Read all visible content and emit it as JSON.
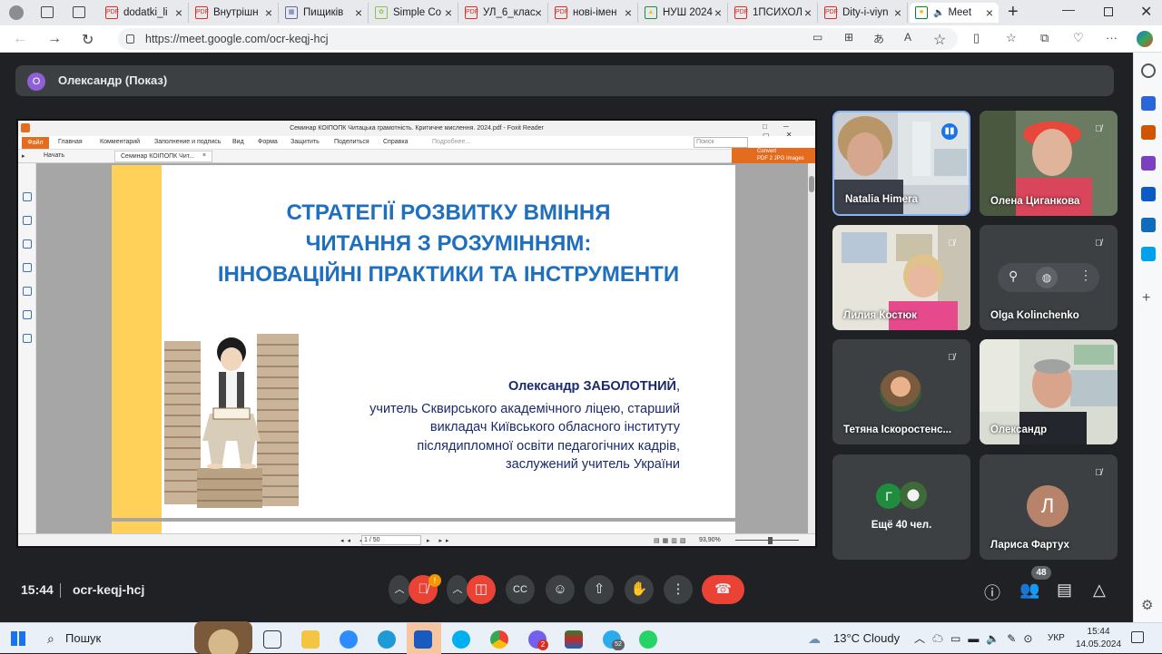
{
  "browser": {
    "tabs": [
      {
        "label": "dodatki_li"
      },
      {
        "label": "Внутрішн"
      },
      {
        "label": "Пищиків"
      },
      {
        "label": "Simple Co"
      },
      {
        "label": "УЛ_6_клас"
      },
      {
        "label": "нові-імен"
      },
      {
        "label": "НУШ 2024"
      },
      {
        "label": "1ПСИХОЛ"
      },
      {
        "label": "Dity-i-viyn"
      },
      {
        "label": "Meet"
      }
    ],
    "url": "https://meet.google.com/ocr-keqj-hcj"
  },
  "meet": {
    "presenter_initial": "О",
    "presenter_label": "Олександр (Показ)",
    "time": "15:44",
    "meeting_code": "ocr-keqj-hcj",
    "people_count": "48",
    "mic_badge": "!",
    "more_people_initial": "Г",
    "more_people_label": "Ещё 40 чел."
  },
  "foxit": {
    "title": "Семинар КОІПОПК Читацька грамотність. Критичне мислення. 2024.pdf - Foxit Reader",
    "menu": [
      "Файл",
      "Главная",
      "Комментарий",
      "Заполнение и подпись",
      "Вид",
      "Форма",
      "Защитить",
      "Поделиться",
      "Справка",
      "Подробнее..."
    ],
    "search_placeholder": "Поиск",
    "tabs": [
      "Начать",
      "Семинар КОІПОПК Чит..."
    ],
    "convert_line1": "Convert",
    "convert_line2": "PDF 2 JPG Images",
    "page_indicator": "1 / 50",
    "zoom": "93,90%"
  },
  "slide": {
    "title_lines": [
      "СТРАТЕГІЇ РОЗВИТКУ ВМІННЯ",
      "ЧИТАННЯ З РОЗУМІННЯМ:",
      "ІННОВАЦІЙНІ ПРАКТИКИ ТА ІНСТРУМЕНТИ"
    ],
    "author_name": "Олександр ЗАБОЛОТНИЙ",
    "author_comma": ",",
    "author_lines": [
      "учитель Сквирського академічного ліцею, старший",
      "викладач Київського обласного інституту",
      "післядипломної освіти педагогічних кадрів,",
      "заслужений учитель України"
    ]
  },
  "participants": [
    {
      "name": "Natalia Himera"
    },
    {
      "name": "Олена Циганкова"
    },
    {
      "name": "Лилия Костюк"
    },
    {
      "name": "Olga Kolinchenko"
    },
    {
      "name": "Тетяна Іскоростенс..."
    },
    {
      "name": "Олександр"
    },
    {
      "name": "Лариса Фартух",
      "initial": "Л"
    }
  ],
  "taskbar": {
    "search": "Пошук",
    "weather": "13°C  Cloudy",
    "lang": "УКР",
    "time": "15:44",
    "date": "14.05.2024",
    "badge_viber": "2",
    "badge_telegram": "52"
  },
  "colors": {
    "accent_orange": "#e46c1f",
    "meet_red": "#ea4335",
    "slide_blue": "#1f6fbf",
    "stripe_yellow": "#ffd159"
  }
}
